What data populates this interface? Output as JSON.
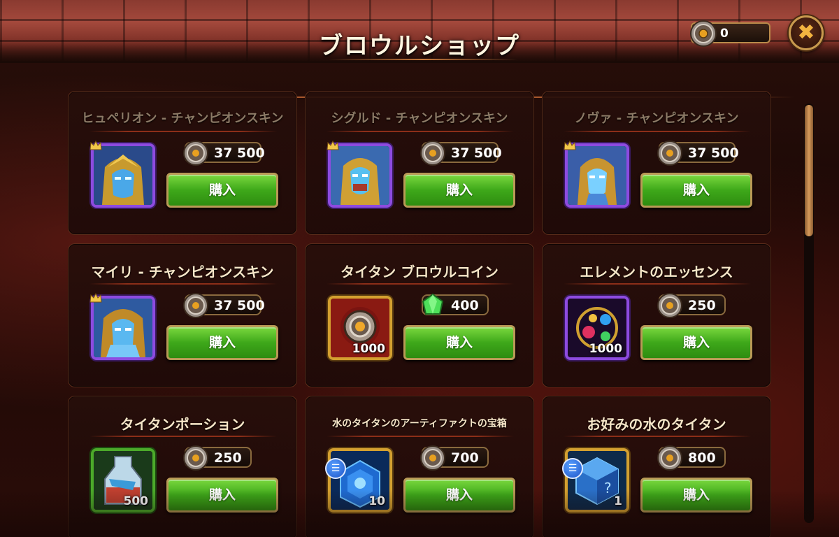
{
  "header": {
    "title": "ブロウルショップ",
    "currency_value": "0",
    "close_icon": "close-icon"
  },
  "colors": {
    "buy_button": "#3ea81a",
    "frame_purple": "#8d4be0",
    "frame_gold": "#d4a030",
    "frame_green": "#4caa2a",
    "title_text": "#fff6e0"
  },
  "items": [
    {
      "name": "ヒュペリオン - チャンピオンスキン",
      "price": "37 500",
      "currency": "brawl-coin",
      "buy_label": "購入",
      "frame": "purple",
      "qty": ""
    },
    {
      "name": "シグルド - チャンピオンスキン",
      "price": "37 500",
      "currency": "brawl-coin",
      "buy_label": "購入",
      "frame": "purple",
      "qty": ""
    },
    {
      "name": "ノヴァ - チャンピオンスキン",
      "price": "37 500",
      "currency": "brawl-coin",
      "buy_label": "購入",
      "frame": "purple",
      "qty": ""
    },
    {
      "name": "マイリ - チャンピオンスキン",
      "price": "37 500",
      "currency": "brawl-coin",
      "buy_label": "購入",
      "frame": "purple",
      "qty": ""
    },
    {
      "name": "タイタン ブロウルコイン",
      "price": "400",
      "currency": "emerald",
      "buy_label": "購入",
      "frame": "gold",
      "qty": "1000"
    },
    {
      "name": "エレメントのエッセンス",
      "price": "250",
      "currency": "brawl-coin",
      "buy_label": "購入",
      "frame": "purple",
      "qty": "1000"
    },
    {
      "name": "タイタンポーション",
      "price": "250",
      "currency": "brawl-coin",
      "buy_label": "購入",
      "frame": "green",
      "qty": "500"
    },
    {
      "name": "水のタイタンのアーティファクトの宝箱",
      "price": "700",
      "currency": "brawl-coin",
      "buy_label": "購入",
      "frame": "gold",
      "qty": "10"
    },
    {
      "name": "お好みの水のタイタン",
      "price": "800",
      "currency": "brawl-coin",
      "buy_label": "購入",
      "frame": "gold",
      "qty": "1"
    }
  ]
}
